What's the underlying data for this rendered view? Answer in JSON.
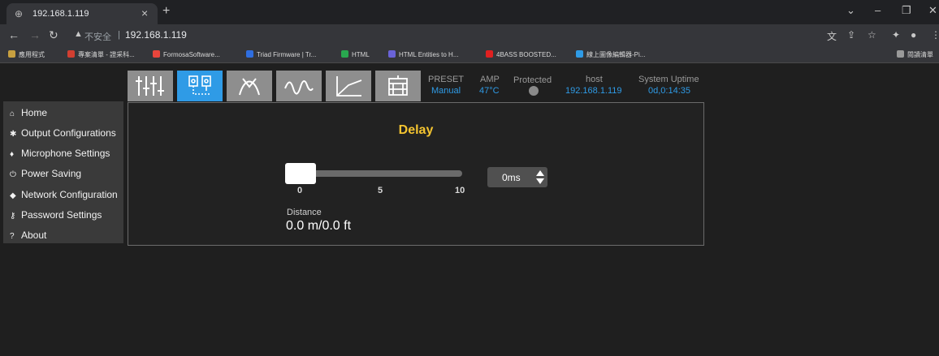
{
  "browser": {
    "tab_title": "192.168.1.119",
    "tab_favicon": "globe-icon",
    "url_insecure_label": "不安全",
    "url": "192.168.1.119",
    "bookmarks": [
      {
        "label": "應用程式",
        "color": "#c8a040"
      },
      {
        "label": "專案清單 - 證采科...",
        "color": "#d23f31"
      },
      {
        "label": "FormosaSoftware...",
        "color": "#e8453c"
      },
      {
        "label": "Triad Firmware | Tr...",
        "color": "#2f6ee0"
      },
      {
        "label": "HTML",
        "color": "#29a84f"
      },
      {
        "label": "HTML Entities to H...",
        "color": "#6a63d8"
      },
      {
        "label": "4BASS BOOSTED...",
        "color": "#e02020"
      },
      {
        "label": "線上圖像編輯器-Pi...",
        "color": "#2f9be6"
      }
    ],
    "reading_list": "閱讀清單"
  },
  "sidebar": {
    "items": [
      {
        "icon": "home-icon",
        "glyph": "⌂",
        "label": "Home"
      },
      {
        "icon": "gear-icon",
        "glyph": "✱",
        "label": "Output Configurations"
      },
      {
        "icon": "microphone-icon",
        "glyph": "♦",
        "label": "Microphone Settings"
      },
      {
        "icon": "power-icon",
        "glyph": "⏻",
        "label": "Power Saving"
      },
      {
        "icon": "wifi-icon",
        "glyph": "◆",
        "label": "Network Configuration"
      },
      {
        "icon": "key-icon",
        "glyph": "⚷",
        "label": "Password Settings"
      },
      {
        "icon": "question-icon",
        "glyph": "?",
        "label": "About"
      }
    ]
  },
  "toolbar": {
    "tools": [
      {
        "icon": "equalizer-sliders-icon",
        "active": false
      },
      {
        "icon": "delay-speakers-icon",
        "active": true
      },
      {
        "icon": "crossover-filter-icon",
        "active": false
      },
      {
        "icon": "waveform-icon",
        "active": false
      },
      {
        "icon": "compressor-curve-icon",
        "active": false
      },
      {
        "icon": "router-matrix-icon",
        "active": false
      }
    ]
  },
  "status": {
    "preset_label": "PRESET",
    "preset_value": "Manual",
    "amp_label": "AMP",
    "amp_value": "47°C",
    "protected_label": "Protected",
    "host_label": "host",
    "host_value": "192.168.1.119",
    "uptime_label": "System Uptime",
    "uptime_value": "0d,0:14:35"
  },
  "delay_panel": {
    "title": "Delay",
    "slider": {
      "min": 0,
      "max": 10,
      "value": 0,
      "tick_labels": [
        "0",
        "5",
        "10"
      ]
    },
    "spinner_value": "0ms",
    "distance_label": "Distance",
    "distance_value": "0.0 m/0.0 ft"
  },
  "colors": {
    "accent": "#2f9be6",
    "title": "#f4c430"
  }
}
